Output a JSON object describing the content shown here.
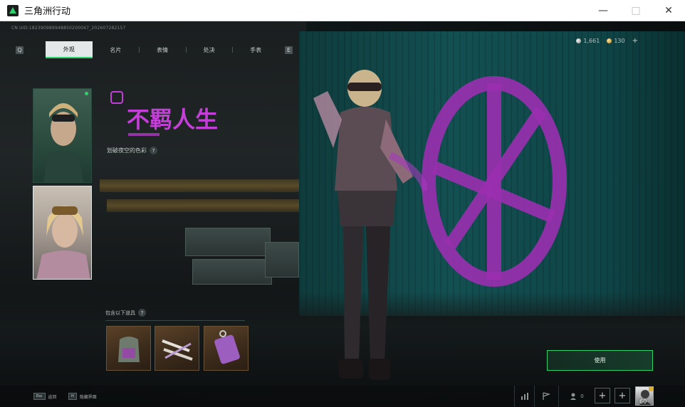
{
  "window": {
    "title": "三角洲行动",
    "minimize_icon": "minimize-icon",
    "maximize_icon": "maximize-icon",
    "close_icon": "close-icon"
  },
  "uid_text": "CN UID:18239098994885020004​7_202607282157",
  "tabs": [
    {
      "label": "外观",
      "active": true
    },
    {
      "label": "名片",
      "active": false
    },
    {
      "label": "表情",
      "active": false
    },
    {
      "label": "处决",
      "active": false
    },
    {
      "label": "手表",
      "active": false
    }
  ],
  "tab_prev_key": "Q",
  "tab_next_key": "E",
  "currency": {
    "silver_amount": "1,661",
    "gold_amount": "130",
    "add_label": "+"
  },
  "skin": {
    "name_art_text": "不羁人生",
    "description": "划破夜空的色彩",
    "help_label": "?"
  },
  "contents": {
    "label": "包含以下道具",
    "help_label": "?",
    "items": [
      "backpack-item",
      "feather-accessory-item",
      "weapon-charm-item"
    ]
  },
  "use_button_label": "使用",
  "bottom": {
    "hint1_key": "Esc",
    "hint1_label": "返回",
    "hint2_key": "H",
    "hint2_label": "隐藏界面",
    "friends_count": "0",
    "level": "60"
  },
  "colors": {
    "accent": "#2ed06e",
    "wall": "#135052",
    "graffiti": "#9b2fb0"
  }
}
